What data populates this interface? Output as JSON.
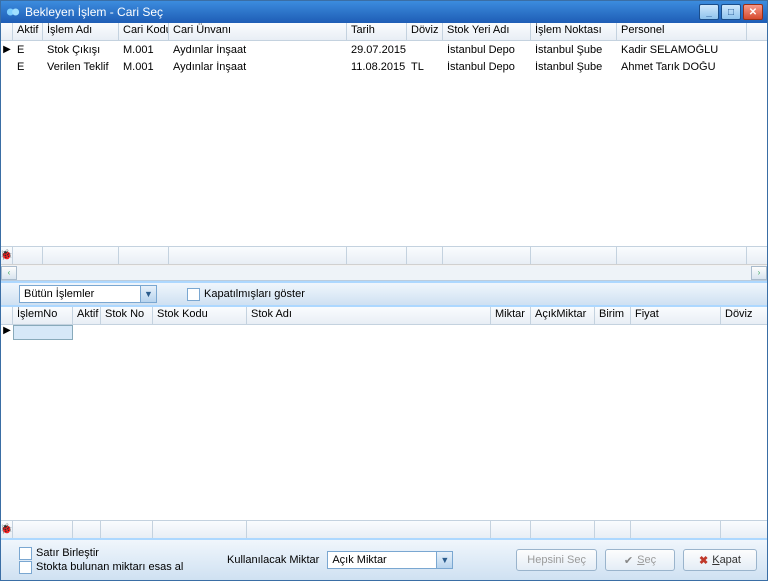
{
  "window": {
    "title": "Bekleyen İşlem - Cari Seç"
  },
  "top_grid": {
    "headers": {
      "aktif": "Aktif",
      "islem_adi": "İşlem Adı",
      "cari_kodu": "Cari Kodu",
      "cari_unvani": "Cari Ünvanı",
      "tarih": "Tarih",
      "doviz": "Döviz",
      "stok_yeri_adi": "Stok Yeri Adı",
      "islem_noktasi": "İşlem Noktası",
      "personel": "Personel"
    },
    "rows": [
      {
        "aktif": "E",
        "islem_adi": "Stok Çıkışı",
        "cari_kodu": "M.001",
        "cari_unvani": "Aydınlar İnşaat",
        "tarih": "29.07.2015",
        "doviz": "",
        "stok_yeri": "İstanbul Depo",
        "islem_noktasi": "İstanbul Şube",
        "personel": "Kadir SELAMOĞLU"
      },
      {
        "aktif": "E",
        "islem_adi": "Verilen Teklif",
        "cari_kodu": "M.001",
        "cari_unvani": "Aydınlar İnşaat",
        "tarih": "11.08.2015",
        "doviz": "TL",
        "stok_yeri": "İstanbul Depo",
        "islem_noktasi": "İstanbul Şube",
        "personel": "Ahmet Tarık DOĞU"
      }
    ]
  },
  "filter_bar": {
    "islem_filter": "Bütün İşlemler",
    "kapatilmis_label": "Kapatılmışları göster"
  },
  "bottom_grid": {
    "headers": {
      "islem_no": "İşlemNo",
      "aktif": "Aktif",
      "stok_no": "Stok No",
      "stok_kodu": "Stok Kodu",
      "stok_adi": "Stok Adı",
      "miktar": "Miktar",
      "acik_miktar": "AçıkMiktar",
      "birim": "Birim",
      "fiyat": "Fiyat",
      "doviz": "Döviz"
    }
  },
  "bottom_bar": {
    "satir_birlestir": "Satır Birleştir",
    "stokta_bulunan": "Stokta bulunan miktarı esas al",
    "kullanilacak_label": "Kullanılacak Miktar",
    "kullanilacak_value": "Açık Miktar",
    "hepsini_sec": "Hepsini Seç",
    "sec_prefix": "S",
    "sec_rest": "eç",
    "kapat_prefix": "K",
    "kapat_rest": "apat"
  }
}
